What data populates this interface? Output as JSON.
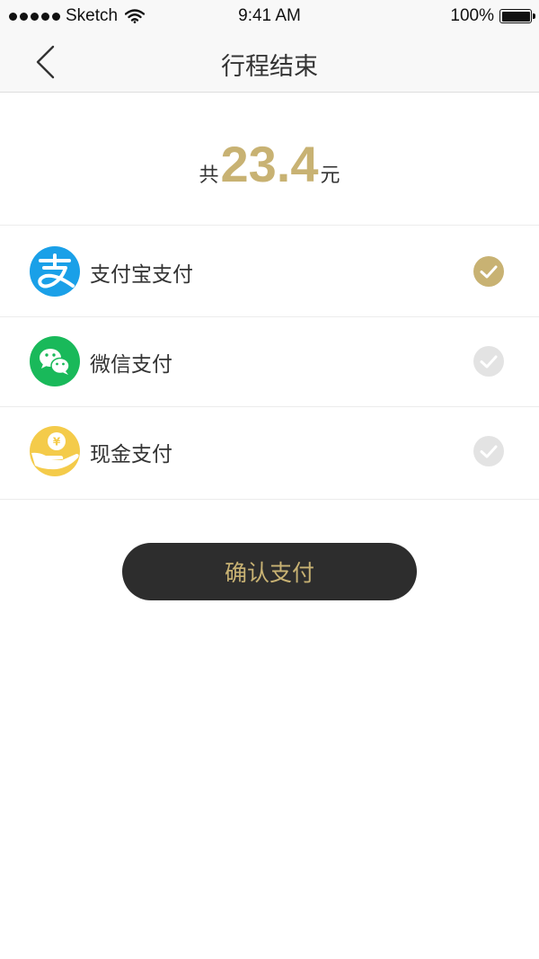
{
  "status_bar": {
    "carrier": "Sketch",
    "time": "9:41 AM",
    "battery": "100%"
  },
  "nav": {
    "title": "行程结束"
  },
  "total": {
    "prefix": "共",
    "amount": "23.4",
    "suffix": "元"
  },
  "payment_methods": [
    {
      "label": "支付宝支付",
      "icon": "alipay-icon",
      "selected": true
    },
    {
      "label": "微信支付",
      "icon": "wechat-icon",
      "selected": false
    },
    {
      "label": "现金支付",
      "icon": "cash-icon",
      "selected": false
    }
  ],
  "confirm_label": "确认支付",
  "colors": {
    "accent": "#c8b273",
    "alipay": "#1aa0e8",
    "wechat": "#19b95a",
    "cash": "#f4cb4a",
    "check_inactive": "#e3e3e3",
    "button_bg": "#2d2d2d"
  }
}
